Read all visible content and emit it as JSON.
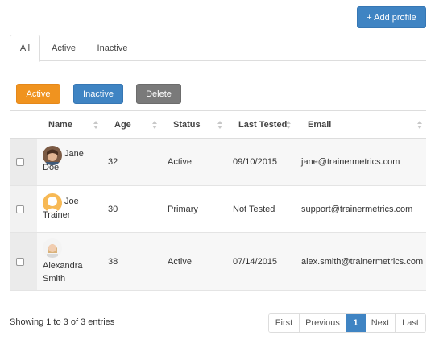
{
  "header": {
    "add_profile_label": "+ Add profile"
  },
  "tabs": [
    {
      "label": "All"
    },
    {
      "label": "Active"
    },
    {
      "label": "Inactive"
    }
  ],
  "actions": {
    "active_label": "Active",
    "inactive_label": "Inactive",
    "delete_label": "Delete"
  },
  "table": {
    "columns": [
      "Name",
      "Age",
      "Status",
      "Last Tested",
      "Email"
    ],
    "rows": [
      {
        "first": "Jane",
        "last": "Doe",
        "age": "32",
        "status": "Active",
        "last_tested": "09/10/2015",
        "email": "jane@trainermetrics.com",
        "avatar": "photo"
      },
      {
        "first": "Joe",
        "last": "Trainer",
        "age": "30",
        "status": "Primary",
        "last_tested": "Not Tested",
        "email": "support@trainermetrics.com",
        "avatar": "silhouette"
      },
      {
        "first": "Alexandra",
        "last": "Smith",
        "age": "38",
        "status": "Active",
        "last_tested": "07/14/2015",
        "email": "alex.smith@trainermetrics.com",
        "avatar": "photo"
      }
    ]
  },
  "footer": {
    "info": "Showing 1 to 3 of 3 entries",
    "pagination": {
      "first": "First",
      "previous": "Previous",
      "current": "1",
      "next": "Next",
      "last": "Last"
    }
  },
  "colors": {
    "primary": "#3f84c3",
    "orange": "#f0931f",
    "gray": "#7a7a7a",
    "avatar_placeholder": "#f7b955"
  }
}
